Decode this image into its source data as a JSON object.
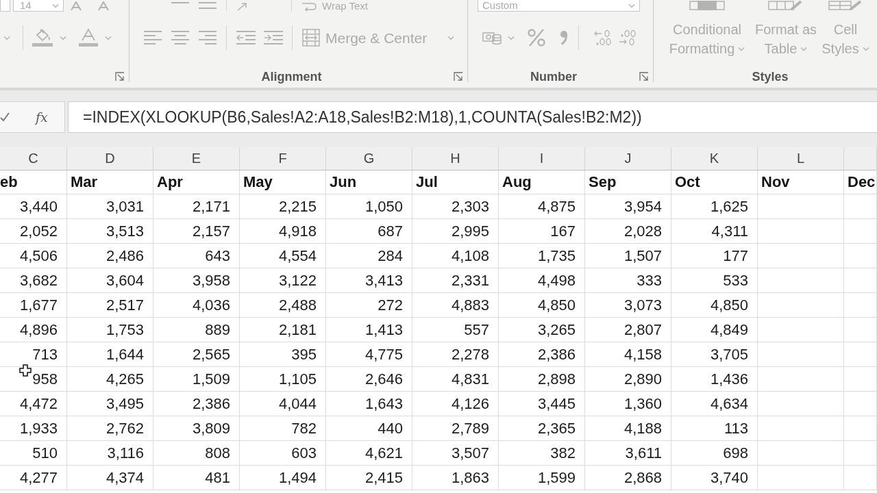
{
  "ribbon": {
    "disabled": true,
    "font_group": {
      "font_size": "14"
    },
    "alignment_group": {
      "wrap_text": "Wrap Text",
      "merge_center": "Merge & Center",
      "label": "Alignment"
    },
    "number_group": {
      "number_format": "Custom",
      "label": "Number"
    },
    "styles_group": {
      "buttons": [
        {
          "kind": "conditional",
          "lines": [
            "Conditional",
            "Formatting"
          ]
        },
        {
          "kind": "table",
          "lines": [
            "Format as",
            "Table"
          ]
        },
        {
          "kind": "cell",
          "lines": [
            "Cell",
            "Styles"
          ]
        }
      ],
      "label": "Styles"
    }
  },
  "formula_bar": {
    "function_symbol": "fx",
    "formula": "=INDEX(XLOOKUP(B6,Sales!A2:A18,Sales!B2:M18),1,COUNTA(Sales!B2:M2))"
  },
  "sheet": {
    "column_letters": [
      "C",
      "D",
      "E",
      "F",
      "G",
      "H",
      "I",
      "J",
      "K",
      "L"
    ],
    "header_row": [
      "eb",
      "Mar",
      "Apr",
      "May",
      "Jun",
      "Jul",
      "Aug",
      "Sep",
      "Oct",
      "Nov",
      "Dec"
    ],
    "rows": [
      [
        "3,440",
        "3,031",
        "2,171",
        "2,215",
        "1,050",
        "2,303",
        "4,875",
        "3,954",
        "1,625"
      ],
      [
        "2,052",
        "3,513",
        "2,157",
        "4,918",
        "687",
        "2,995",
        "167",
        "2,028",
        "4,311"
      ],
      [
        "4,506",
        "2,486",
        "643",
        "4,554",
        "284",
        "4,108",
        "1,735",
        "1,507",
        "177"
      ],
      [
        "3,682",
        "3,604",
        "3,958",
        "3,122",
        "3,413",
        "2,331",
        "4,498",
        "333",
        "533"
      ],
      [
        "1,677",
        "2,517",
        "4,036",
        "2,488",
        "272",
        "4,883",
        "4,850",
        "3,073",
        "4,850"
      ],
      [
        "4,896",
        "1,753",
        "889",
        "2,181",
        "1,413",
        "557",
        "3,265",
        "2,807",
        "4,849"
      ],
      [
        "713",
        "1,644",
        "2,565",
        "395",
        "4,775",
        "2,278",
        "2,386",
        "4,158",
        "3,705"
      ],
      [
        "958",
        "4,265",
        "1,509",
        "1,105",
        "2,646",
        "4,831",
        "2,898",
        "2,890",
        "1,436"
      ],
      [
        "4,472",
        "3,495",
        "2,386",
        "4,044",
        "1,643",
        "4,126",
        "3,445",
        "1,360",
        "4,634"
      ],
      [
        "1,933",
        "2,762",
        "3,809",
        "782",
        "440",
        "2,789",
        "2,365",
        "4,188",
        "113"
      ],
      [
        "510",
        "3,116",
        "808",
        "603",
        "4,621",
        "3,507",
        "382",
        "3,611",
        "698"
      ],
      [
        "4,277",
        "4,374",
        "481",
        "1,494",
        "2,415",
        "1,863",
        "1,599",
        "2,868",
        "3,740"
      ]
    ]
  }
}
